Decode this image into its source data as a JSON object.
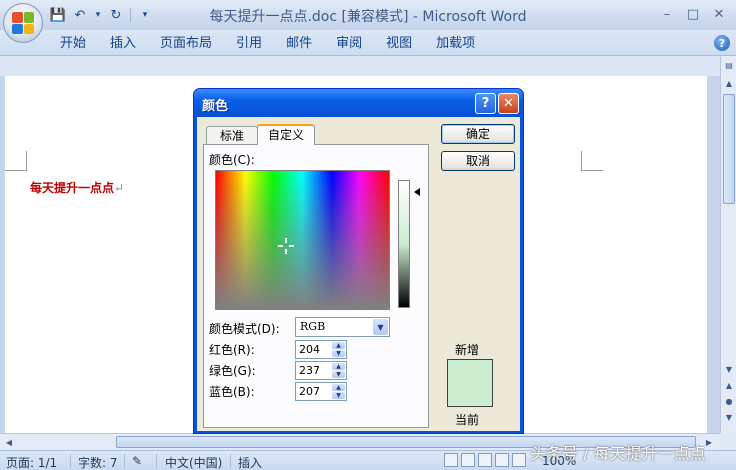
{
  "window": {
    "title": "每天提升一点点.doc [兼容模式] - Microsoft Word",
    "controls": {
      "minimize": "–",
      "maximize": "□",
      "close": "✕"
    }
  },
  "quick_access": {
    "icons": [
      "save-icon",
      "undo-icon",
      "redo-icon",
      "customize-icon"
    ],
    "glyphs": {
      "save": "💾",
      "undo": "↶",
      "undo_drop": "▾",
      "redo": "↻",
      "customize": "▾"
    }
  },
  "ribbon": {
    "tabs": [
      "开始",
      "插入",
      "页面布局",
      "引用",
      "邮件",
      "审阅",
      "视图",
      "加载项"
    ],
    "help_glyph": "?"
  },
  "document": {
    "text": "每天提升一点点",
    "paragraph_mark": "↵"
  },
  "dialog": {
    "title": "颜色",
    "help_glyph": "?",
    "close_glyph": "✕",
    "ok_label": "确定",
    "cancel_label": "取消",
    "tabs": [
      "标准",
      "自定义"
    ],
    "active_tab": "自定义",
    "colors_label": "颜色(C):",
    "color_model_label": "颜色模式(D):",
    "color_model_value": "RGB",
    "red_label": "红色(R):",
    "green_label": "绿色(G):",
    "blue_label": "蓝色(B):",
    "red_value": "204",
    "green_value": "237",
    "blue_value": "207",
    "new_label": "新增",
    "current_label": "当前",
    "new_color": "#CCEDCF",
    "current_color": "#CCEDCF",
    "spin_up_glyph": "▲",
    "spin_down_glyph": "▼",
    "dropdown_glyph": "▼"
  },
  "status_bar": {
    "page": "页面: 1/1",
    "words": "字数: 7",
    "language": "中文(中国)",
    "mode": "插入",
    "zoom": "100%"
  },
  "watermark": "头条号 / 每天提升一点点",
  "colors": {
    "doc_text": "#C00000",
    "dialog_frame": "#0A54D8",
    "dialog_body": "#ECE9D8"
  }
}
